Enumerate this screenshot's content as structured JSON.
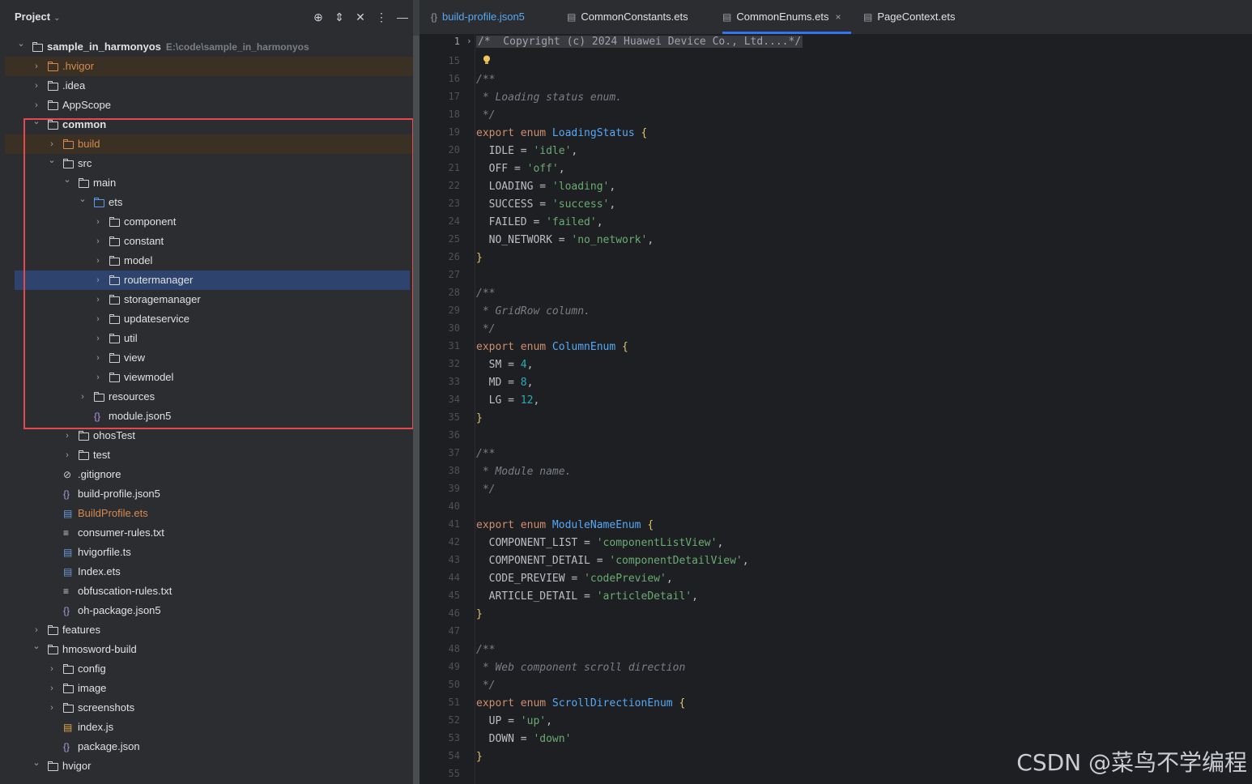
{
  "project_panel": {
    "title": "Project",
    "tree": [
      {
        "label": "sample_in_harmonyos",
        "path": "E:\\code\\sample_in_harmonyos",
        "type": "module-folder",
        "depth": 0,
        "expanded": true,
        "bold": true
      },
      {
        "label": ".hvigor",
        "type": "folder",
        "depth": 1,
        "expanded": false,
        "color": "orange",
        "highlight": true
      },
      {
        "label": ".idea",
        "type": "folder",
        "depth": 1,
        "expanded": false
      },
      {
        "label": "AppScope",
        "type": "folder",
        "depth": 1,
        "expanded": false
      },
      {
        "label": "common",
        "type": "module-folder",
        "depth": 1,
        "expanded": true,
        "bold": true
      },
      {
        "label": "build",
        "type": "folder",
        "depth": 2,
        "expanded": false,
        "color": "orange",
        "highlight": true
      },
      {
        "label": "src",
        "type": "folder",
        "depth": 2,
        "expanded": true
      },
      {
        "label": "main",
        "type": "folder",
        "depth": 3,
        "expanded": true
      },
      {
        "label": "ets",
        "type": "folder",
        "depth": 4,
        "expanded": true,
        "color": "blue"
      },
      {
        "label": "component",
        "type": "folder",
        "depth": 5,
        "expanded": false
      },
      {
        "label": "constant",
        "type": "folder",
        "depth": 5,
        "expanded": false
      },
      {
        "label": "model",
        "type": "folder",
        "depth": 5,
        "expanded": false
      },
      {
        "label": "routermanager",
        "type": "folder",
        "depth": 5,
        "expanded": false,
        "selected": true
      },
      {
        "label": "storagemanager",
        "type": "folder",
        "depth": 5,
        "expanded": false
      },
      {
        "label": "updateservice",
        "type": "folder",
        "depth": 5,
        "expanded": false
      },
      {
        "label": "util",
        "type": "folder",
        "depth": 5,
        "expanded": false
      },
      {
        "label": "view",
        "type": "folder",
        "depth": 5,
        "expanded": false
      },
      {
        "label": "viewmodel",
        "type": "folder",
        "depth": 5,
        "expanded": false
      },
      {
        "label": "resources",
        "type": "folder",
        "depth": 4,
        "expanded": false
      },
      {
        "label": "module.json5",
        "type": "json",
        "depth": 4
      },
      {
        "label": "ohosTest",
        "type": "folder",
        "depth": 3,
        "expanded": false
      },
      {
        "label": "test",
        "type": "folder",
        "depth": 3,
        "expanded": false
      },
      {
        "label": ".gitignore",
        "type": "ignore",
        "depth": 2
      },
      {
        "label": "build-profile.json5",
        "type": "json",
        "depth": 2
      },
      {
        "label": "BuildProfile.ets",
        "type": "ets",
        "depth": 2,
        "color": "orange"
      },
      {
        "label": "consumer-rules.txt",
        "type": "txt",
        "depth": 2
      },
      {
        "label": "hvigorfile.ts",
        "type": "ts",
        "depth": 2
      },
      {
        "label": "Index.ets",
        "type": "ets",
        "depth": 2
      },
      {
        "label": "obfuscation-rules.txt",
        "type": "txt",
        "depth": 2
      },
      {
        "label": "oh-package.json5",
        "type": "json",
        "depth": 2
      },
      {
        "label": "features",
        "type": "folder",
        "depth": 1,
        "expanded": false
      },
      {
        "label": "hmosword-build",
        "type": "folder",
        "depth": 1,
        "expanded": true
      },
      {
        "label": "config",
        "type": "folder",
        "depth": 2,
        "expanded": false
      },
      {
        "label": "image",
        "type": "folder",
        "depth": 2,
        "expanded": false
      },
      {
        "label": "screenshots",
        "type": "folder",
        "depth": 2,
        "expanded": false
      },
      {
        "label": "index.js",
        "type": "js",
        "depth": 2
      },
      {
        "label": "package.json",
        "type": "json",
        "depth": 2
      },
      {
        "label": "hvigor",
        "type": "folder",
        "depth": 1,
        "expanded": true
      }
    ]
  },
  "tabs": [
    {
      "label": "build-profile.json5",
      "icon": "json-icon",
      "active": false,
      "color": "#56a8f5"
    },
    {
      "label": "CommonConstants.ets",
      "icon": "ets-file-icon",
      "active": false
    },
    {
      "label": "CommonEnums.ets",
      "icon": "ets-file-icon",
      "active": true,
      "close": "×"
    },
    {
      "label": "PageContext.ets",
      "icon": "ets-file-icon",
      "active": false
    }
  ],
  "editor": {
    "collapsed_header": {
      "line": "1",
      "text": "/*  Copyright (c) 2024 Huawei Device Co., Ltd....*/"
    },
    "lines": [
      {
        "n": "15",
        "tokens": []
      },
      {
        "n": "16",
        "tokens": [
          [
            "cm",
            "/**"
          ]
        ]
      },
      {
        "n": "17",
        "tokens": [
          [
            "cm",
            " * Loading status enum."
          ]
        ]
      },
      {
        "n": "18",
        "tokens": [
          [
            "cm",
            " */"
          ]
        ]
      },
      {
        "n": "19",
        "tokens": [
          [
            "kw",
            "export enum "
          ],
          [
            "en",
            "LoadingStatus"
          ],
          [
            "br",
            " {"
          ]
        ]
      },
      {
        "n": "20",
        "tokens": [
          [
            "pl",
            "  IDLE = "
          ],
          [
            "st",
            "'idle'"
          ],
          [
            "pl",
            ","
          ]
        ]
      },
      {
        "n": "21",
        "tokens": [
          [
            "pl",
            "  OFF = "
          ],
          [
            "st",
            "'off'"
          ],
          [
            "pl",
            ","
          ]
        ]
      },
      {
        "n": "22",
        "tokens": [
          [
            "pl",
            "  LOADING = "
          ],
          [
            "st",
            "'loading'"
          ],
          [
            "pl",
            ","
          ]
        ]
      },
      {
        "n": "23",
        "tokens": [
          [
            "pl",
            "  SUCCESS = "
          ],
          [
            "st",
            "'success'"
          ],
          [
            "pl",
            ","
          ]
        ]
      },
      {
        "n": "24",
        "tokens": [
          [
            "pl",
            "  FAILED = "
          ],
          [
            "st",
            "'failed'"
          ],
          [
            "pl",
            ","
          ]
        ]
      },
      {
        "n": "25",
        "tokens": [
          [
            "pl",
            "  NO_NETWORK = "
          ],
          [
            "st",
            "'no_network'"
          ],
          [
            "pl",
            ","
          ]
        ]
      },
      {
        "n": "26",
        "tokens": [
          [
            "br",
            "}"
          ]
        ]
      },
      {
        "n": "27",
        "tokens": []
      },
      {
        "n": "28",
        "tokens": [
          [
            "cm",
            "/**"
          ]
        ]
      },
      {
        "n": "29",
        "tokens": [
          [
            "cm",
            " * GridRow column."
          ]
        ]
      },
      {
        "n": "30",
        "tokens": [
          [
            "cm",
            " */"
          ]
        ]
      },
      {
        "n": "31",
        "tokens": [
          [
            "kw",
            "export enum "
          ],
          [
            "en",
            "ColumnEnum"
          ],
          [
            "br",
            " {"
          ]
        ]
      },
      {
        "n": "32",
        "tokens": [
          [
            "pl",
            "  SM = "
          ],
          [
            "nm",
            "4"
          ],
          [
            "pl",
            ","
          ]
        ]
      },
      {
        "n": "33",
        "tokens": [
          [
            "pl",
            "  MD = "
          ],
          [
            "nm",
            "8"
          ],
          [
            "pl",
            ","
          ]
        ]
      },
      {
        "n": "34",
        "tokens": [
          [
            "pl",
            "  LG = "
          ],
          [
            "nm",
            "12"
          ],
          [
            "pl",
            ","
          ]
        ]
      },
      {
        "n": "35",
        "tokens": [
          [
            "br",
            "}"
          ]
        ]
      },
      {
        "n": "36",
        "tokens": []
      },
      {
        "n": "37",
        "tokens": [
          [
            "cm",
            "/**"
          ]
        ]
      },
      {
        "n": "38",
        "tokens": [
          [
            "cm",
            " * Module name."
          ]
        ]
      },
      {
        "n": "39",
        "tokens": [
          [
            "cm",
            " */"
          ]
        ]
      },
      {
        "n": "40",
        "tokens": []
      },
      {
        "n": "41",
        "tokens": [
          [
            "kw",
            "export enum "
          ],
          [
            "en",
            "ModuleNameEnum"
          ],
          [
            "br",
            " {"
          ]
        ]
      },
      {
        "n": "42",
        "tokens": [
          [
            "pl",
            "  COMPONENT_LIST = "
          ],
          [
            "st",
            "'componentListView'"
          ],
          [
            "pl",
            ","
          ]
        ]
      },
      {
        "n": "43",
        "tokens": [
          [
            "pl",
            "  COMPONENT_DETAIL = "
          ],
          [
            "st",
            "'componentDetailView'"
          ],
          [
            "pl",
            ","
          ]
        ]
      },
      {
        "n": "44",
        "tokens": [
          [
            "pl",
            "  CODE_PREVIEW = "
          ],
          [
            "st",
            "'codePreview'"
          ],
          [
            "pl",
            ","
          ]
        ]
      },
      {
        "n": "45",
        "tokens": [
          [
            "pl",
            "  ARTICLE_DETAIL = "
          ],
          [
            "st",
            "'articleDetail'"
          ],
          [
            "pl",
            ","
          ]
        ]
      },
      {
        "n": "46",
        "tokens": [
          [
            "br",
            "}"
          ]
        ]
      },
      {
        "n": "47",
        "tokens": []
      },
      {
        "n": "48",
        "tokens": [
          [
            "cm",
            "/**"
          ]
        ]
      },
      {
        "n": "49",
        "tokens": [
          [
            "cm",
            " * Web component scroll direction"
          ]
        ]
      },
      {
        "n": "50",
        "tokens": [
          [
            "cm",
            " */"
          ]
        ]
      },
      {
        "n": "51",
        "tokens": [
          [
            "kw",
            "export enum "
          ],
          [
            "en",
            "ScrollDirectionEnum"
          ],
          [
            "br",
            " {"
          ]
        ]
      },
      {
        "n": "52",
        "tokens": [
          [
            "pl",
            "  UP = "
          ],
          [
            "st",
            "'up'"
          ],
          [
            "pl",
            ","
          ]
        ]
      },
      {
        "n": "53",
        "tokens": [
          [
            "pl",
            "  DOWN = "
          ],
          [
            "st",
            "'down'"
          ]
        ]
      },
      {
        "n": "54",
        "tokens": [
          [
            "br",
            "}"
          ]
        ]
      },
      {
        "n": "55",
        "tokens": []
      }
    ]
  },
  "watermark": "CSDN @菜鸟不学编程",
  "colors": {
    "accent": "#3574f0",
    "selection": "#2e436e",
    "highlight_box": "#e5484d"
  }
}
